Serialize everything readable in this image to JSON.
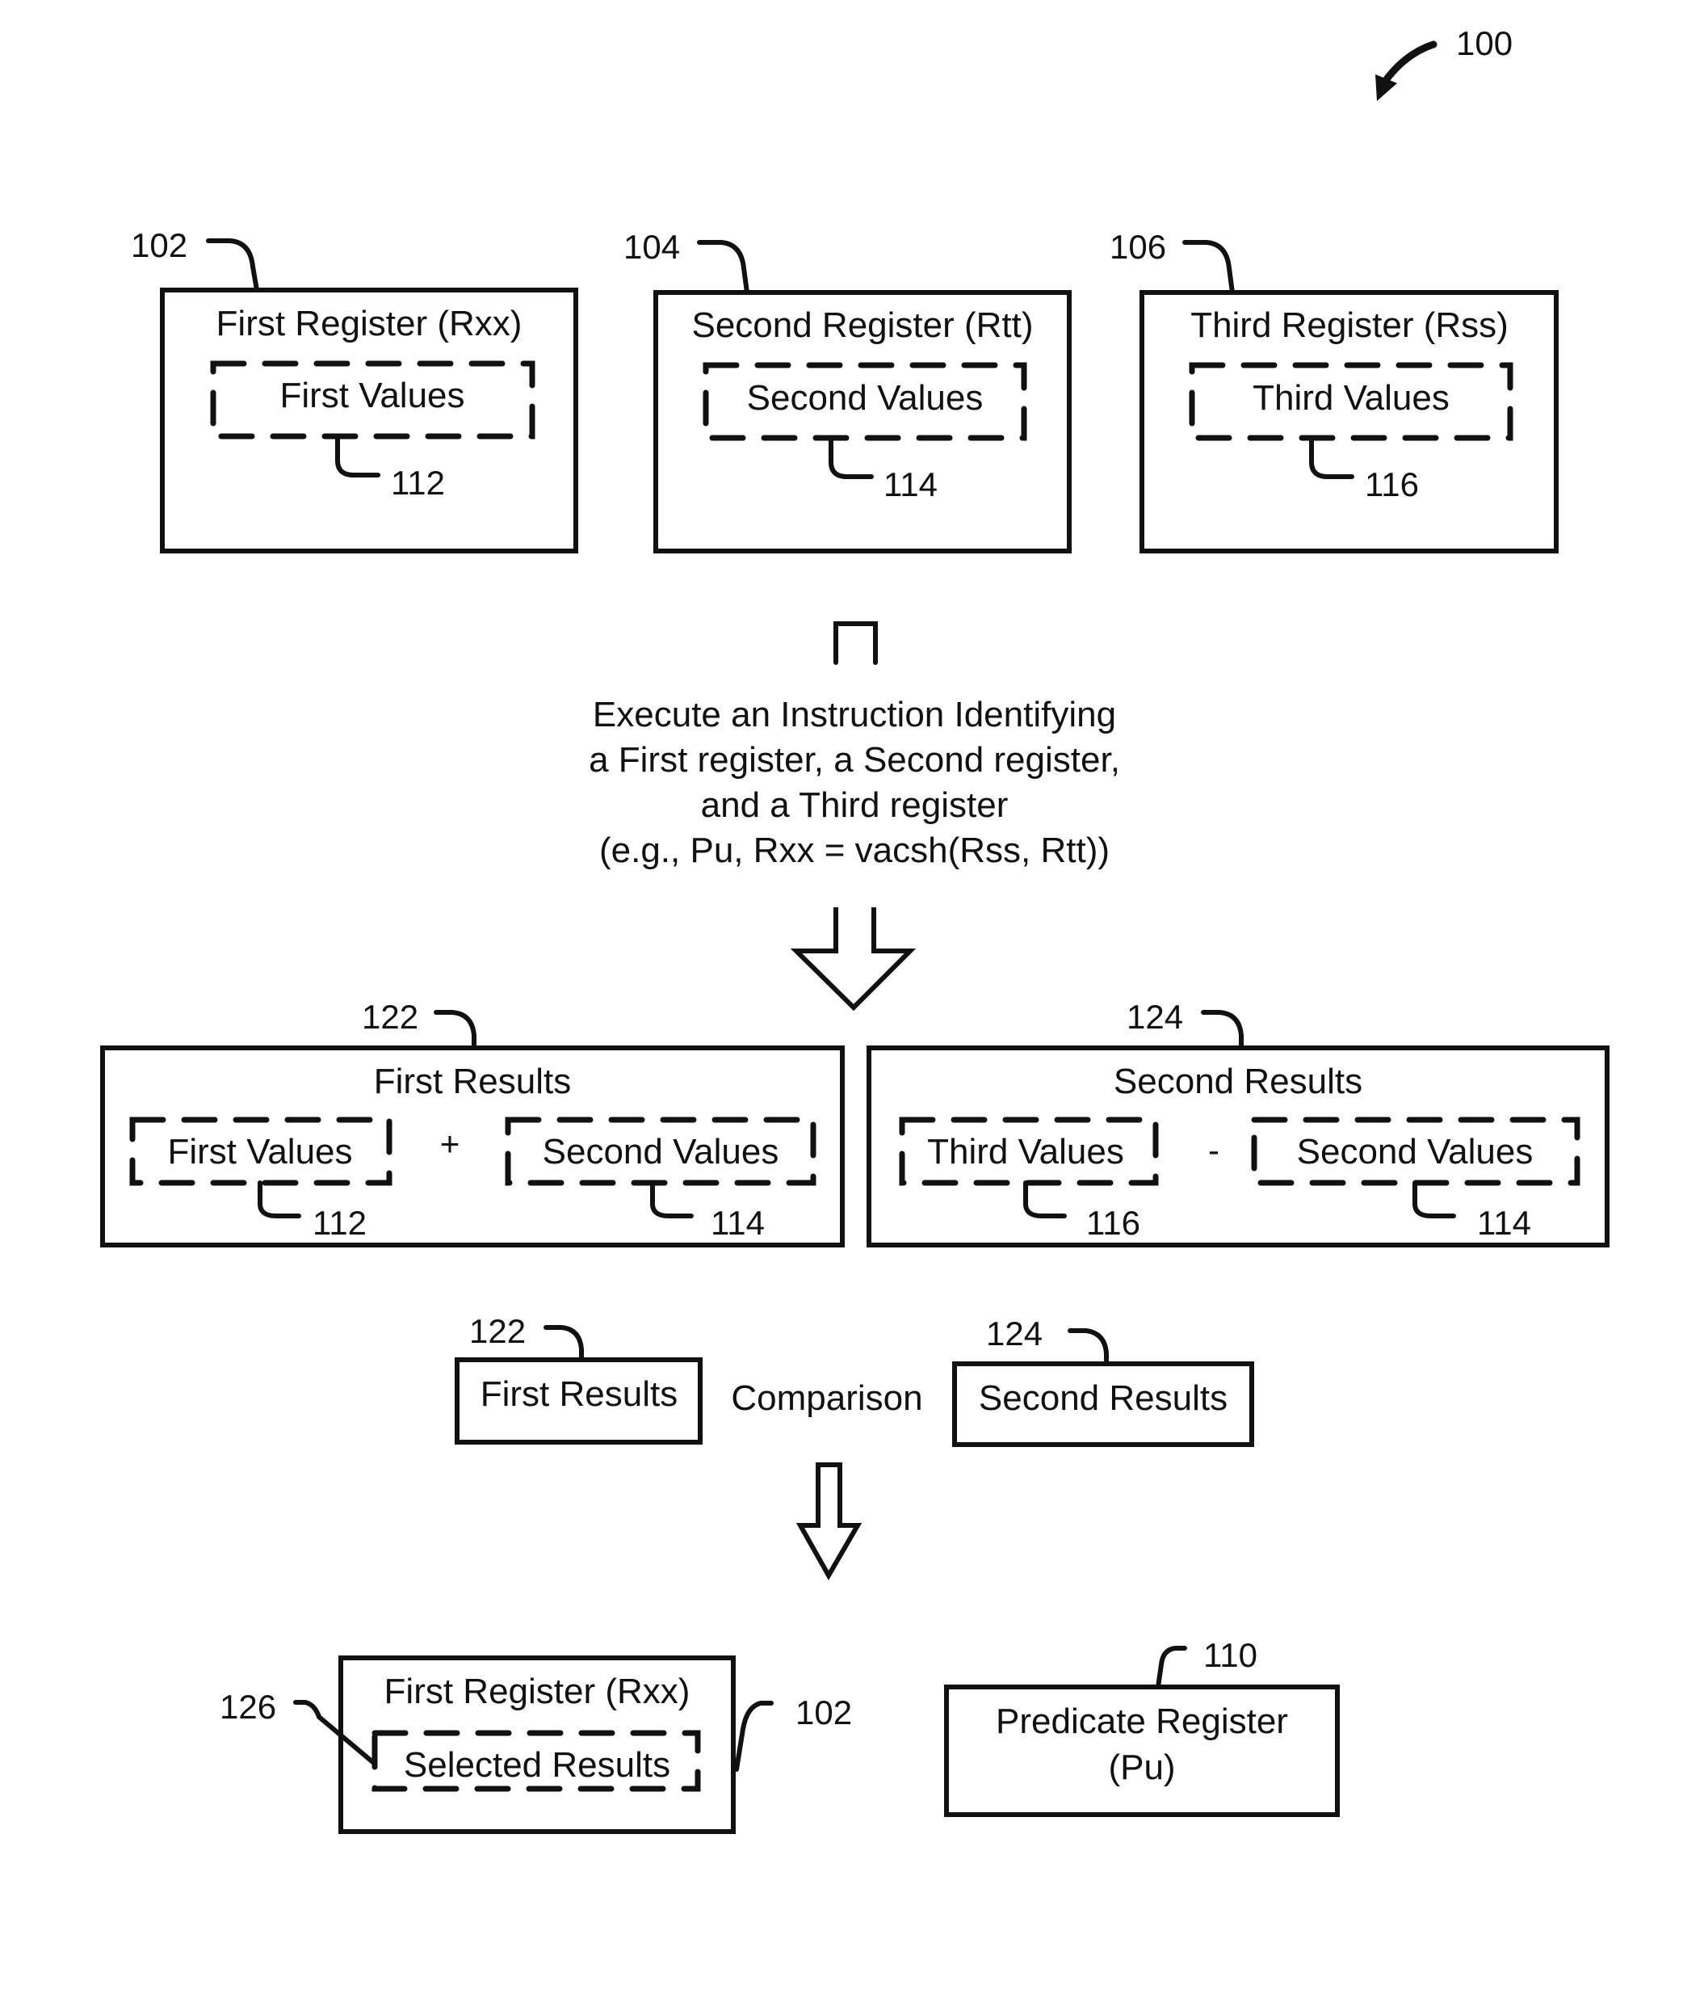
{
  "figure": {
    "ref": "100"
  },
  "registers": [
    {
      "ref": "102",
      "title": "First Register (Rxx)",
      "values_label": "First Values",
      "values_ref": "112"
    },
    {
      "ref": "104",
      "title": "Second Register (Rtt)",
      "values_label": "Second Values",
      "values_ref": "114"
    },
    {
      "ref": "106",
      "title": "Third Register (Rss)",
      "values_label": "Third Values",
      "values_ref": "116"
    }
  ],
  "instruction": {
    "lines": [
      "Execute an Instruction Identifying",
      "a First register, a Second register,",
      "and a Third register",
      "(e.g., Pu, Rxx = vacsh(Rss, Rtt))"
    ]
  },
  "results": [
    {
      "ref": "122",
      "title": "First Results",
      "operator": "+",
      "left": {
        "label": "First Values",
        "ref": "112"
      },
      "right": {
        "label": "Second Values",
        "ref": "114"
      }
    },
    {
      "ref": "124",
      "title": "Second Results",
      "operator": "-",
      "left": {
        "label": "Third Values",
        "ref": "116"
      },
      "right": {
        "label": "Second Values",
        "ref": "114"
      }
    }
  ],
  "comparison": {
    "left": {
      "ref": "122",
      "label": "First Results"
    },
    "label": "Comparison",
    "right": {
      "ref": "124",
      "label": "Second Results"
    }
  },
  "outputs": {
    "first_register": {
      "ref": "102",
      "title": "First Register (Rxx)",
      "selected_label": "Selected Results",
      "selected_ref": "126"
    },
    "predicate_register": {
      "ref": "110",
      "line1": "Predicate Register",
      "line2": "(Pu)"
    }
  }
}
